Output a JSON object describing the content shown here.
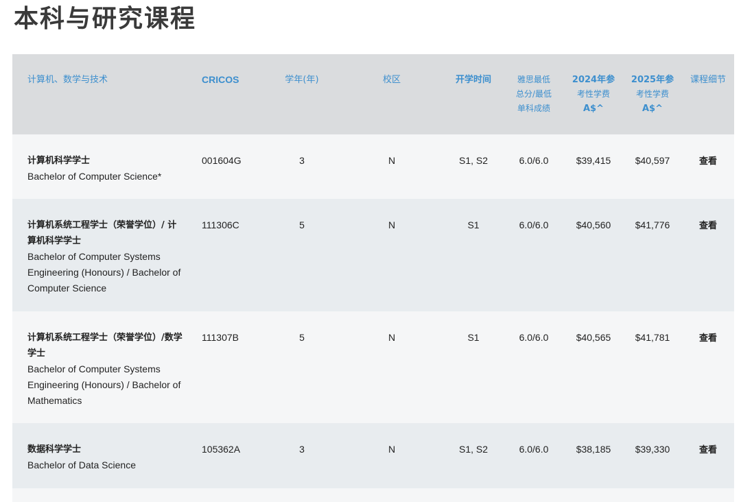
{
  "page": {
    "title": "本科与研究课程"
  },
  "table": {
    "headers": {
      "category": "计算机、数学与技术",
      "cricos": "CRICOS",
      "years": "学年(年)",
      "campus": "校区",
      "intake": "开学时间",
      "ielts_1": "雅思最低",
      "ielts_2": "总分/最低",
      "ielts_3": "单科成绩",
      "fee2024_1": "2024年参",
      "fee2024_2": "考性学费",
      "fee2024_3": "A$^",
      "fee2025_1": "2025年参",
      "fee2025_2": "考性学费",
      "fee2025_3": "A$^",
      "details": "课程细节"
    },
    "rows": [
      {
        "name_zh": "计算机科学学士",
        "name_en": "Bachelor of Computer Science*",
        "cricos": "001604G",
        "years": "3",
        "campus": "N",
        "intake": "S1, S2",
        "ielts": "6.0/6.0",
        "fee2024": "$39,415",
        "fee2025": "$40,597",
        "details": "查看"
      },
      {
        "name_zh": "计算机系统工程学士（荣誉学位）/ 计算机科学学士",
        "name_en": "Bachelor of Computer Systems Engineering (Honours) / Bachelor of Computer Science",
        "cricos": "111306C",
        "years": "5",
        "campus": "N",
        "intake": "S1",
        "ielts": "6.0/6.0",
        "fee2024": "$40,560",
        "fee2025": "$41,776",
        "details": "查看"
      },
      {
        "name_zh": "计算机系统工程学士（荣誉学位）/数学学士",
        "name_en": "Bachelor of Computer Systems Engineering (Honours) / Bachelor of Mathematics",
        "cricos": "111307B",
        "years": "5",
        "campus": "N",
        "intake": "S1",
        "ielts": "6.0/6.0",
        "fee2024": "$40,565",
        "fee2025": "$41,781",
        "details": "查看"
      },
      {
        "name_zh": "数据科学学士",
        "name_en": "Bachelor of Data Science",
        "cricos": "105362A",
        "years": "3",
        "campus": "N",
        "intake": "S1, S2",
        "ielts": "6.0/6.0",
        "fee2024": "$38,185",
        "fee2025": "$39,330",
        "details": "查看"
      }
    ]
  },
  "colors": {
    "header_bg": "#dadcde",
    "header_text": "#3d8fce",
    "row_light": "#f5f6f7",
    "row_dark": "#e8ecef"
  }
}
